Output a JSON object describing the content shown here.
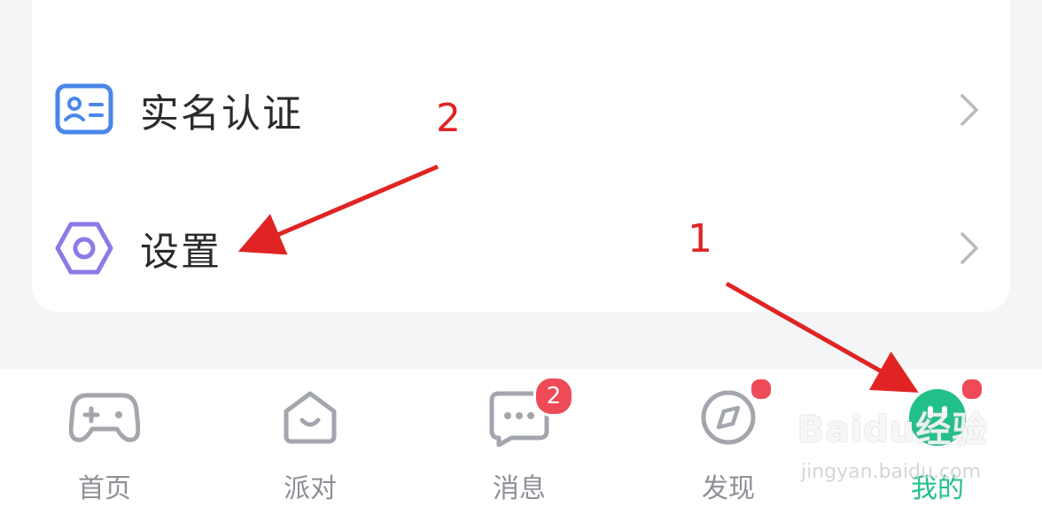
{
  "menu": {
    "items": [
      {
        "label": "实名认证",
        "icon": "id-card-icon"
      },
      {
        "label": "设置",
        "icon": "hexagon-gear-icon"
      }
    ]
  },
  "tabbar": {
    "tabs": [
      {
        "label": "首页",
        "icon": "gamepad-icon",
        "active": false
      },
      {
        "label": "派对",
        "icon": "smile-house-icon",
        "active": false
      },
      {
        "label": "消息",
        "icon": "chat-bubble-icon",
        "active": false,
        "badge": "2"
      },
      {
        "label": "发现",
        "icon": "compass-icon",
        "active": false,
        "dot": true
      },
      {
        "label": "我的",
        "icon": "face-icon",
        "active": true,
        "dot": true
      }
    ]
  },
  "annotations": {
    "step1": "1",
    "step2": "2"
  },
  "watermark": {
    "brand": "Baidu经验",
    "url": "jingyan.baidu.com"
  },
  "colors": {
    "accent_green": "#22c18a",
    "badge_red": "#ef4a57",
    "annotation_red": "#e02424",
    "icon_blue": "#4a86e8",
    "icon_purple": "#8a7be8"
  }
}
